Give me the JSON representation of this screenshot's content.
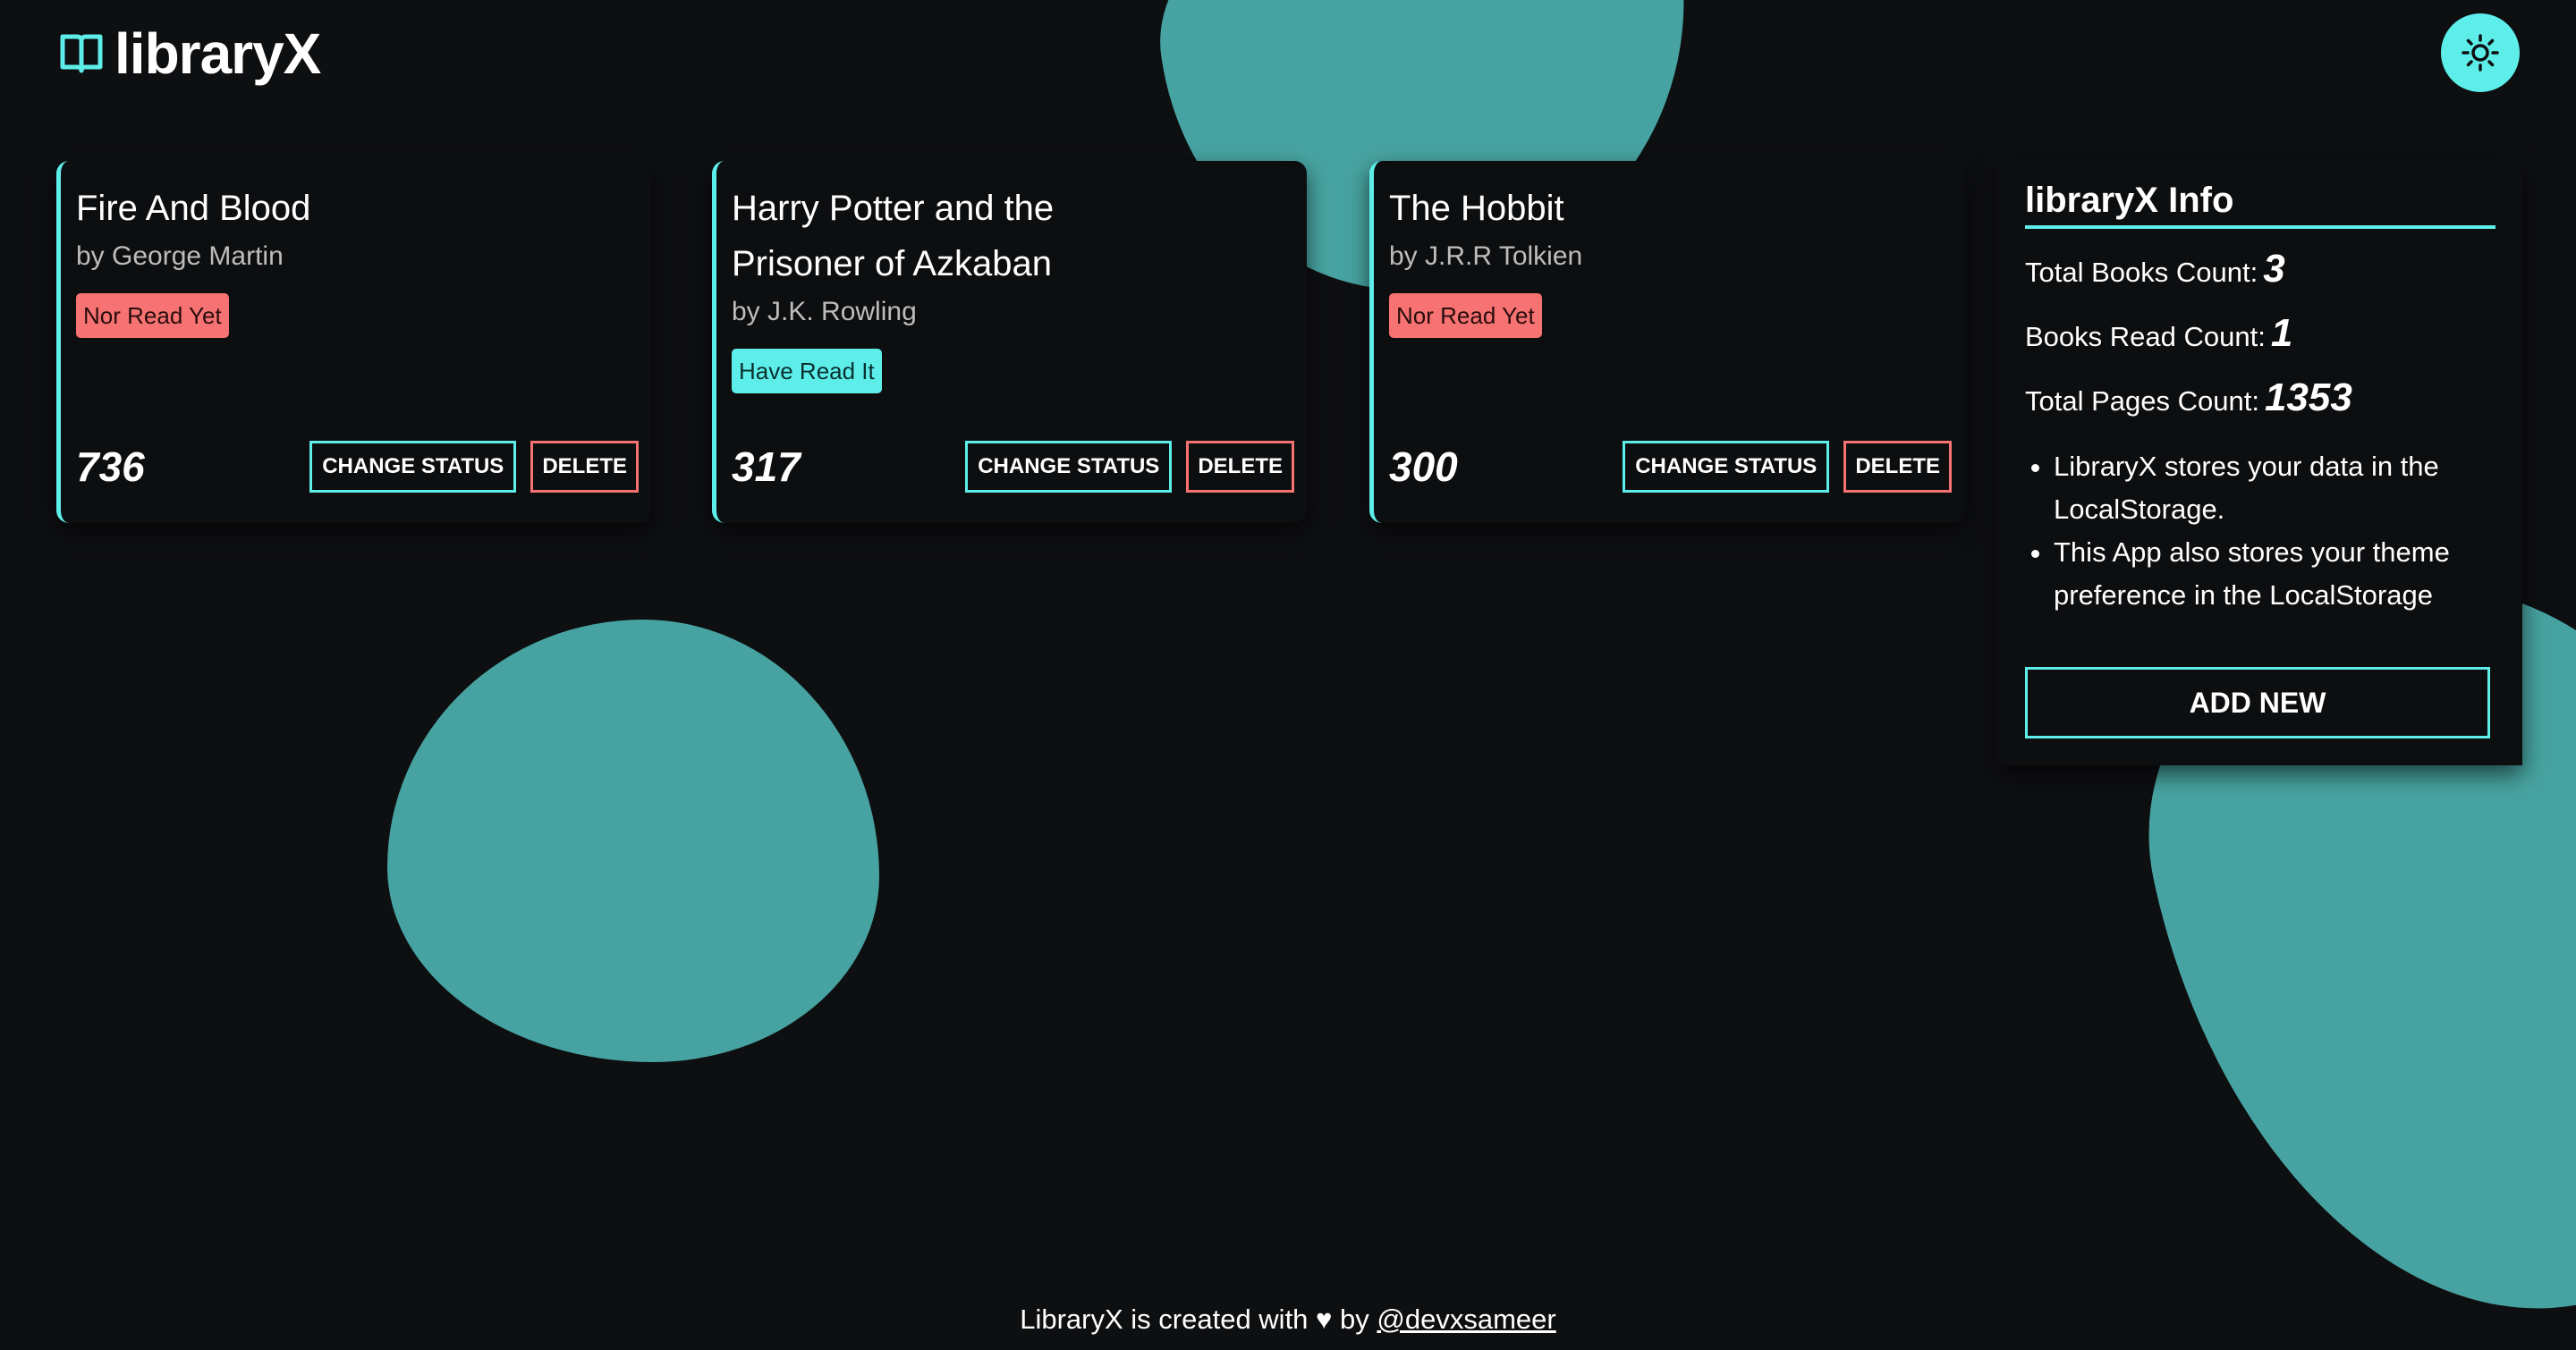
{
  "app": {
    "name": "libraryX"
  },
  "header": {
    "logo_text": "libraryX",
    "logo_icon": "open-book-icon",
    "theme_toggle_icon": "sun-icon"
  },
  "books": [
    {
      "title": "Fire And Blood",
      "author": "by George Martin",
      "status": "Nor Read Yet",
      "read": false,
      "pages": "736",
      "change_status_label": "CHANGE STATUS",
      "delete_label": "DELETE"
    },
    {
      "title": "Harry Potter and the Prisoner of Azkaban",
      "author": "by J.K. Rowling",
      "status": "Have Read It",
      "read": true,
      "pages": "317",
      "change_status_label": "CHANGE STATUS",
      "delete_label": "DELETE"
    },
    {
      "title": "The Hobbit",
      "author": "by J.R.R Tolkien",
      "status": "Nor Read Yet",
      "read": false,
      "pages": "300",
      "change_status_label": "CHANGE STATUS",
      "delete_label": "DELETE"
    }
  ],
  "info": {
    "title": "libraryX Info",
    "total_books_label": "Total Books Count:",
    "total_books_value": "3",
    "books_read_label": "Books Read Count:",
    "books_read_value": "1",
    "total_pages_label": "Total Pages Count:",
    "total_pages_value": "1353",
    "notes": [
      "LibraryX stores your data in the LocalStorage.",
      "This App also stores your theme preference in the LocalStorage"
    ],
    "add_new_label": "ADD NEW"
  },
  "footer": {
    "text": "LibraryX is created with ♥ by",
    "link_text": "@devxsameer"
  },
  "colors": {
    "background": "#0e0f11",
    "accent": "#5eeeea",
    "blob": "#47a3a1",
    "danger": "#f77272"
  }
}
